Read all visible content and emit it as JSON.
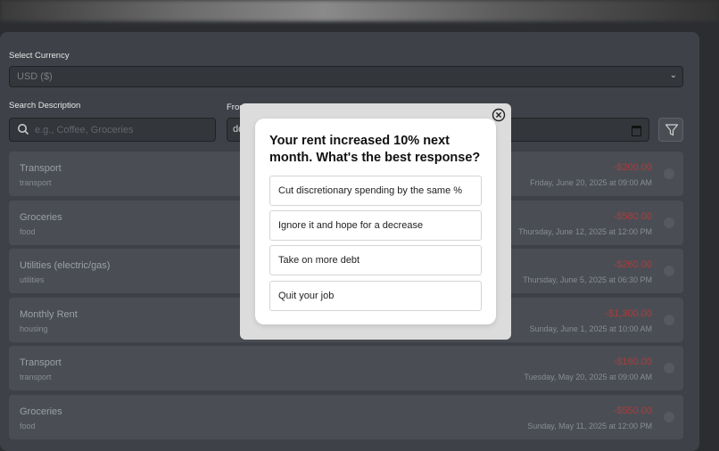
{
  "filters": {
    "currency_label": "Select Currency",
    "currency_value": "USD ($)",
    "search_label": "Search Description",
    "search_placeholder": "e.g., Coffee, Groceries",
    "from_label": "From",
    "from_value": "dd"
  },
  "transactions": [
    {
      "title": "Transport",
      "category": "transport",
      "amount": "-$200.00",
      "date": "Friday, June 20, 2025 at 09:00 AM"
    },
    {
      "title": "Groceries",
      "category": "food",
      "amount": "-$580.00",
      "date": "Thursday, June 12, 2025 at 12:00 PM"
    },
    {
      "title": "Utilities (electric/gas)",
      "category": "utilities",
      "amount": "-$260.00",
      "date": "Thursday, June 5, 2025 at 06:30 PM"
    },
    {
      "title": "Monthly Rent",
      "category": "housing",
      "amount": "-$1,300.00",
      "date": "Sunday, June 1, 2025 at 10:00 AM"
    },
    {
      "title": "Transport",
      "category": "transport",
      "amount": "-$190.00",
      "date": "Tuesday, May 20, 2025 at 09:00 AM"
    },
    {
      "title": "Groceries",
      "category": "food",
      "amount": "-$550.00",
      "date": "Sunday, May 11, 2025 at 12:00 PM"
    }
  ],
  "quiz": {
    "question": "Your rent increased 10% next month. What's the best response?",
    "options": [
      "Cut discretionary spending by the same %",
      "Ignore it and hope for a decrease",
      "Take on more debt",
      "Quit your job"
    ],
    "close_icon": "close-circle-icon"
  },
  "colors": {
    "expense_amount": "#b03a3a",
    "modal_background": "#ffffff",
    "panel_background": "#3e4248"
  }
}
